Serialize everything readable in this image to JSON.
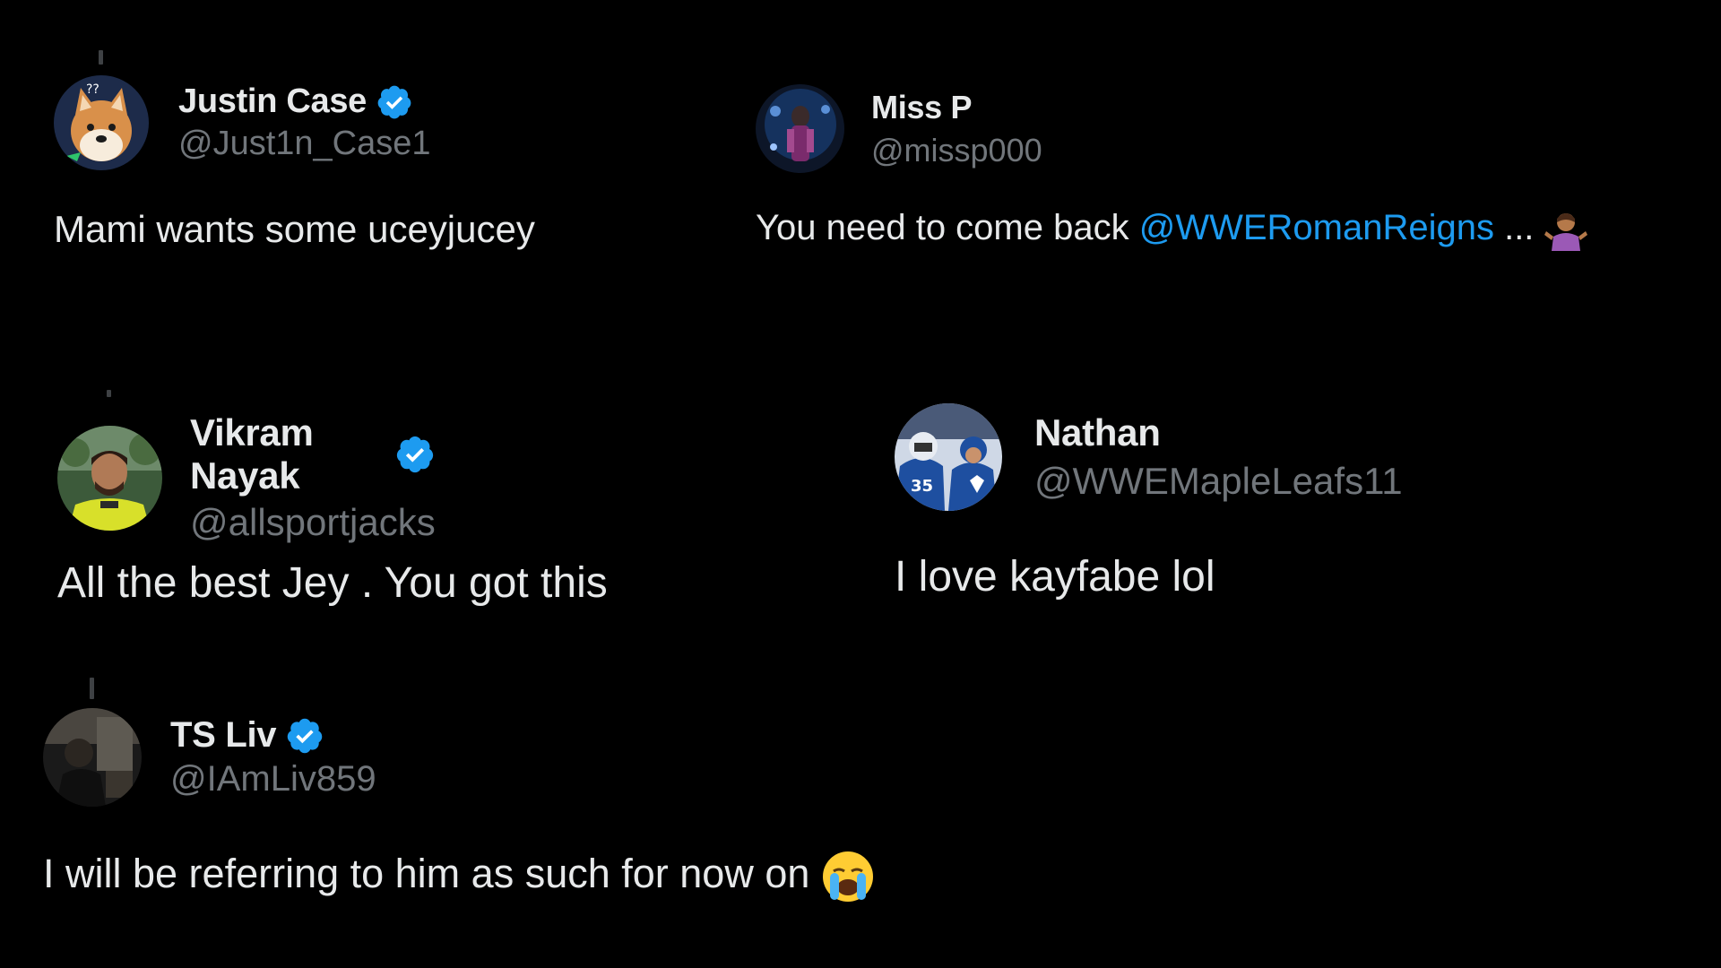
{
  "colors": {
    "background": "#000000",
    "text_primary": "#e7e9ea",
    "text_secondary": "#71767b",
    "link": "#1d9bf0",
    "verified": "#1d9bf0"
  },
  "tweets": [
    {
      "display_name": "Justin Case",
      "handle": "@Just1n_Case1",
      "verified": true,
      "avatar": "shiba-dog-avatar",
      "text": "Mami wants some uceyjucey"
    },
    {
      "display_name": "Miss P",
      "handle": "@missp000",
      "verified": false,
      "avatar": "wrestler-entrance-avatar",
      "text_before": "You need to come back ",
      "mention": "@WWERomanReigns",
      "text_after": " ...",
      "emoji": "person-shrugging-emoji"
    },
    {
      "display_name": "Vikram Nayak",
      "handle": "@allsportjacks",
      "verified": true,
      "avatar": "man-yellow-jersey-avatar",
      "text": "All the best Jey . You got this"
    },
    {
      "display_name": "Nathan",
      "handle": "@WWEMapleLeafs11",
      "verified": false,
      "avatar": "hockey-players-avatar",
      "text": "I love kayfabe lol"
    },
    {
      "display_name": "TS Liv",
      "handle": "@IAmLiv859",
      "verified": true,
      "avatar": "dark-photo-avatar",
      "text": "I will be referring to him as such for now on",
      "emoji": "loudly-crying-face-emoji"
    }
  ]
}
